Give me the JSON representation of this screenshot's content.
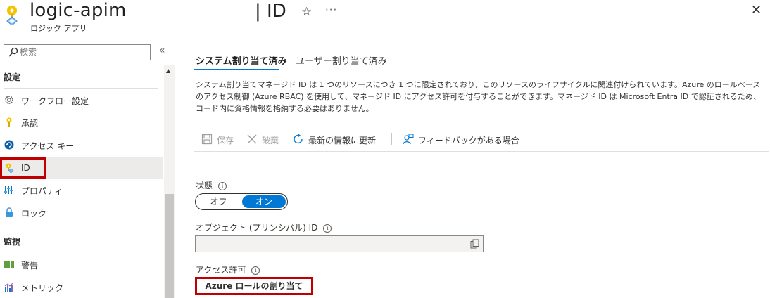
{
  "header": {
    "app_name": "logic-apim",
    "app_subtitle": "ロジック アプリ",
    "page_title": "| ID",
    "favorite_icon": "☆",
    "more_icon": "···",
    "close_icon": "✕"
  },
  "sidebar": {
    "search_placeholder": "検索",
    "collapse_icon": "«",
    "sections": [
      {
        "label": "設定"
      },
      {
        "label": "監視"
      }
    ],
    "items": [
      {
        "label": "ワークフロー設定",
        "icon": "gear-icon"
      },
      {
        "label": "承認",
        "icon": "key-icon"
      },
      {
        "label": "アクセス キー",
        "icon": "refresh-circle-icon"
      },
      {
        "label": "ID",
        "icon": "identity-key-icon",
        "active": true
      },
      {
        "label": "プロパティ",
        "icon": "properties-bars-icon"
      },
      {
        "label": "ロック",
        "icon": "lock-icon"
      },
      {
        "label": "警告",
        "icon": "alert-icon"
      },
      {
        "label": "メトリック",
        "icon": "metrics-chart-icon"
      }
    ]
  },
  "main": {
    "tabs": [
      {
        "label": "システム割り当て済み",
        "active": true
      },
      {
        "label": "ユーザー割り当て済み",
        "active": false
      }
    ],
    "description": "システム割り当てマネージド ID は 1 つのリソースにつき 1 つに限定されており、このリソースのライフサイクルに関連付けられています。Azure のロールベースのアクセス制御 (Azure RBAC) を使用して、マネージド ID にアクセス許可を付与することができます。マネージド ID は Microsoft Entra ID で認証されるため、コード内に資格情報を格納する必要はありません。",
    "toolbar": {
      "save": "保存",
      "discard": "破棄",
      "refresh": "最新の情報に更新",
      "feedback": "フィードバックがある場合"
    },
    "status": {
      "label": "状態",
      "off": "オフ",
      "on": "オン",
      "value": "オン"
    },
    "object_id": {
      "label": "オブジェクト (プリンシパル) ID",
      "value": ""
    },
    "permissions": {
      "label": "アクセス許可",
      "button": "Azure ロールの割り当て"
    }
  },
  "colors": {
    "accent": "#0078d4",
    "highlight": "#c00000",
    "active_nav_bg": "#edebe9"
  }
}
